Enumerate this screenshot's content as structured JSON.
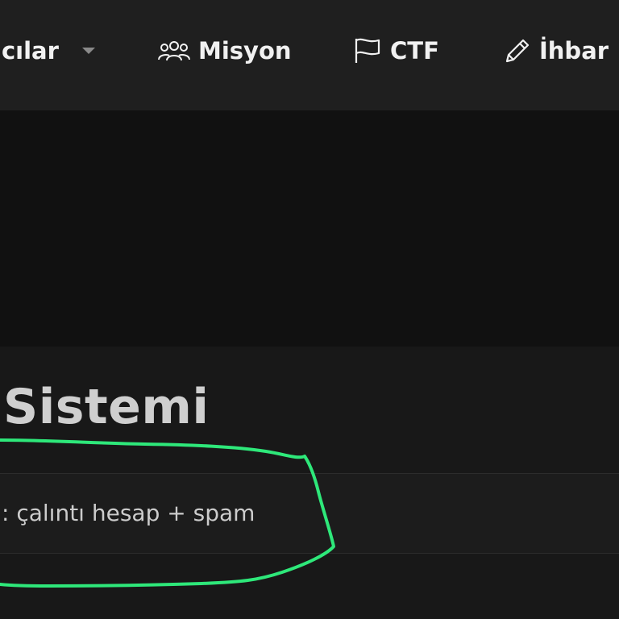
{
  "nav": {
    "items": [
      {
        "id": "users",
        "label": "ıcılar",
        "icon": "chevron-down-icon"
      },
      {
        "id": "misyon",
        "label": "Misyon",
        "icon": "users-icon"
      },
      {
        "id": "ctf",
        "label": "CTF",
        "icon": "flag-icon"
      },
      {
        "id": "ihbar",
        "label": "İhbar",
        "icon": "pencil-icon"
      }
    ]
  },
  "main": {
    "title": "Sistemi",
    "row": {
      "text": ": çalıntı hesap + spam"
    }
  },
  "colors": {
    "navbar_bg": "#1f1f1f",
    "hero_bg": "#111111",
    "content_bg": "#181818",
    "row_bg": "#1c1c1c",
    "title_text": "#cfcfcf",
    "nav_text": "#f1f1f1",
    "annotation_stroke": "#2ee87a"
  }
}
